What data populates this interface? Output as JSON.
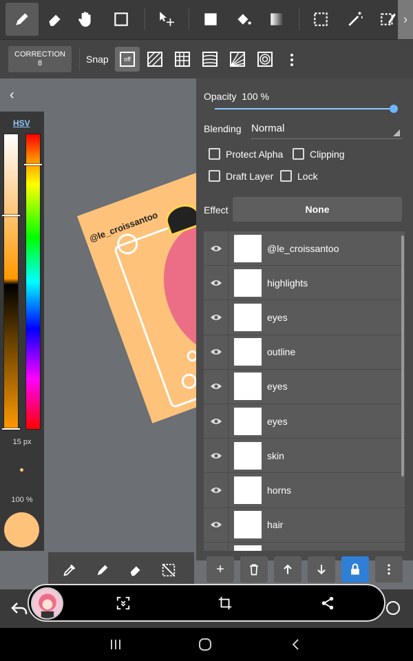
{
  "toolbar": {
    "tools": [
      "pen-icon",
      "eraser-icon",
      "hand-icon",
      "rectangle-icon",
      "move-icon",
      "fill-square-icon",
      "bucket-icon",
      "gradient-icon",
      "select-rect-icon",
      "magic-wand-icon",
      "select-pen-icon"
    ],
    "active_tool": "pen-icon"
  },
  "subbar": {
    "correction_label": "CORRECTION",
    "correction_value": "8",
    "snap_label": "Snap",
    "snap_off_label": "off"
  },
  "color_panel": {
    "mode_label": "HSV",
    "brush_size": "15 px",
    "brush_opacity": "100 %",
    "current_color": "#ffc27a"
  },
  "artwork": {
    "watermark": "@le_croissantoo"
  },
  "layer_panel": {
    "opacity_label": "Opacity",
    "opacity_value": "100 %",
    "opacity_fraction": 1.0,
    "blending_label": "Blending",
    "blending_value": "Normal",
    "checks": {
      "protect_alpha": "Protect Alpha",
      "clipping": "Clipping",
      "draft_layer": "Draft Layer",
      "lock": "Lock"
    },
    "effect_label": "Effect",
    "effect_value": "None",
    "layers": [
      {
        "name": "@le_croissantoo"
      },
      {
        "name": "highlights"
      },
      {
        "name": "eyes"
      },
      {
        "name": "outline"
      },
      {
        "name": "eyes"
      },
      {
        "name": "eyes"
      },
      {
        "name": "skin"
      },
      {
        "name": "horns"
      },
      {
        "name": "hair"
      }
    ]
  },
  "colors": {
    "accent": "#2f7fd6",
    "slider": "#8fc8ff"
  }
}
